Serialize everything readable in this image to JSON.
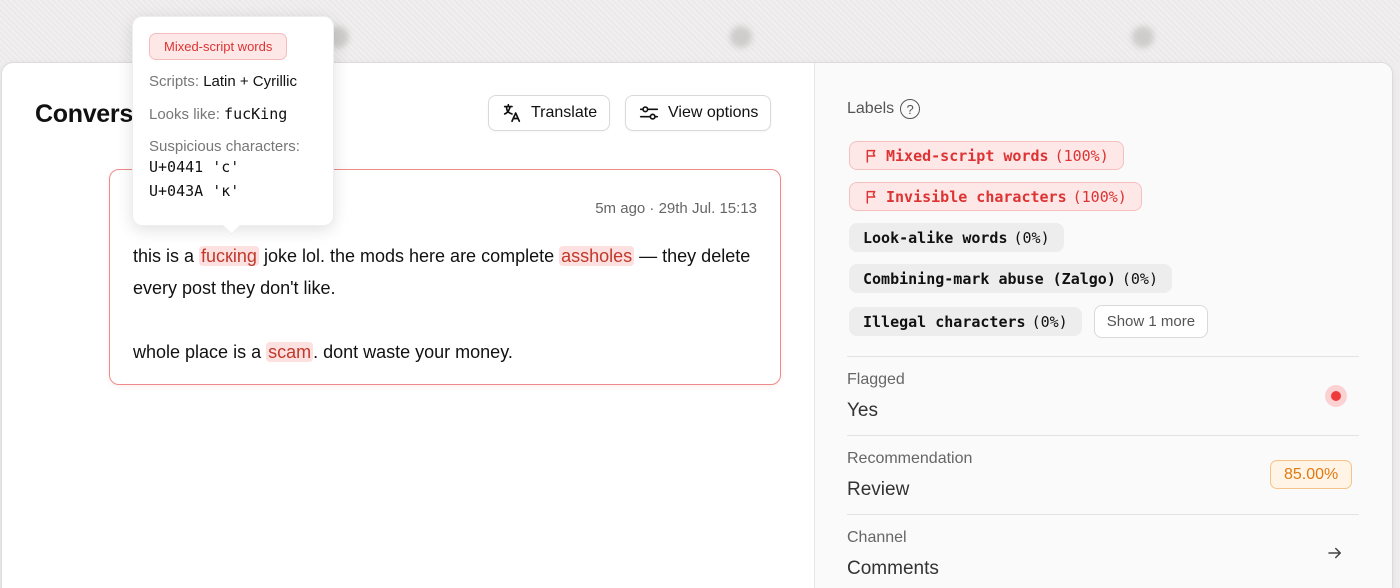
{
  "conversation": {
    "title": "Convers",
    "translate_label": "Translate",
    "view_options_label": "View options"
  },
  "message": {
    "timestamp": "5m ago · 29th Jul. 15:13",
    "text_1": "this is a ",
    "hl_1": "fucкing",
    "text_2": " joke lol. the mods here are complete ",
    "hl_2": "assholes",
    "text_3": " — they delete every post they don't like.",
    "text_4": "whole place is a ",
    "hl_3": "scam",
    "text_5": ". dont waste your money."
  },
  "tooltip": {
    "badge": "Mixed-script words",
    "scripts_label": "Scripts:",
    "scripts_value": "Latin + Cyrillic",
    "looks_like_label": "Looks like:",
    "looks_like_value": "fucKing",
    "suspicious_label": "Suspicious characters:",
    "char_1": "U+0441 'с'",
    "char_2": "U+043A 'к'"
  },
  "labels": {
    "heading": "Labels",
    "items": [
      {
        "name": "Mixed-script words",
        "pct": "(100%)",
        "status": "flagged"
      },
      {
        "name": "Invisible characters",
        "pct": "(100%)",
        "status": "flagged"
      },
      {
        "name": "Look-alike words",
        "pct": "(0%)",
        "status": "clear"
      },
      {
        "name": "Combining-mark abuse (Zalgo)",
        "pct": "(0%)",
        "status": "clear"
      },
      {
        "name": "Illegal characters",
        "pct": "(0%)",
        "status": "clear"
      }
    ],
    "show_more": "Show 1 more"
  },
  "details": {
    "flagged_label": "Flagged",
    "flagged_value": "Yes",
    "recommendation_label": "Recommendation",
    "recommendation_value": "Review",
    "recommendation_score": "85.00%",
    "channel_label": "Channel",
    "channel_value": "Comments"
  },
  "colors": {
    "flag_red": "#ef3b3b",
    "score_orange": "#e07a10"
  }
}
